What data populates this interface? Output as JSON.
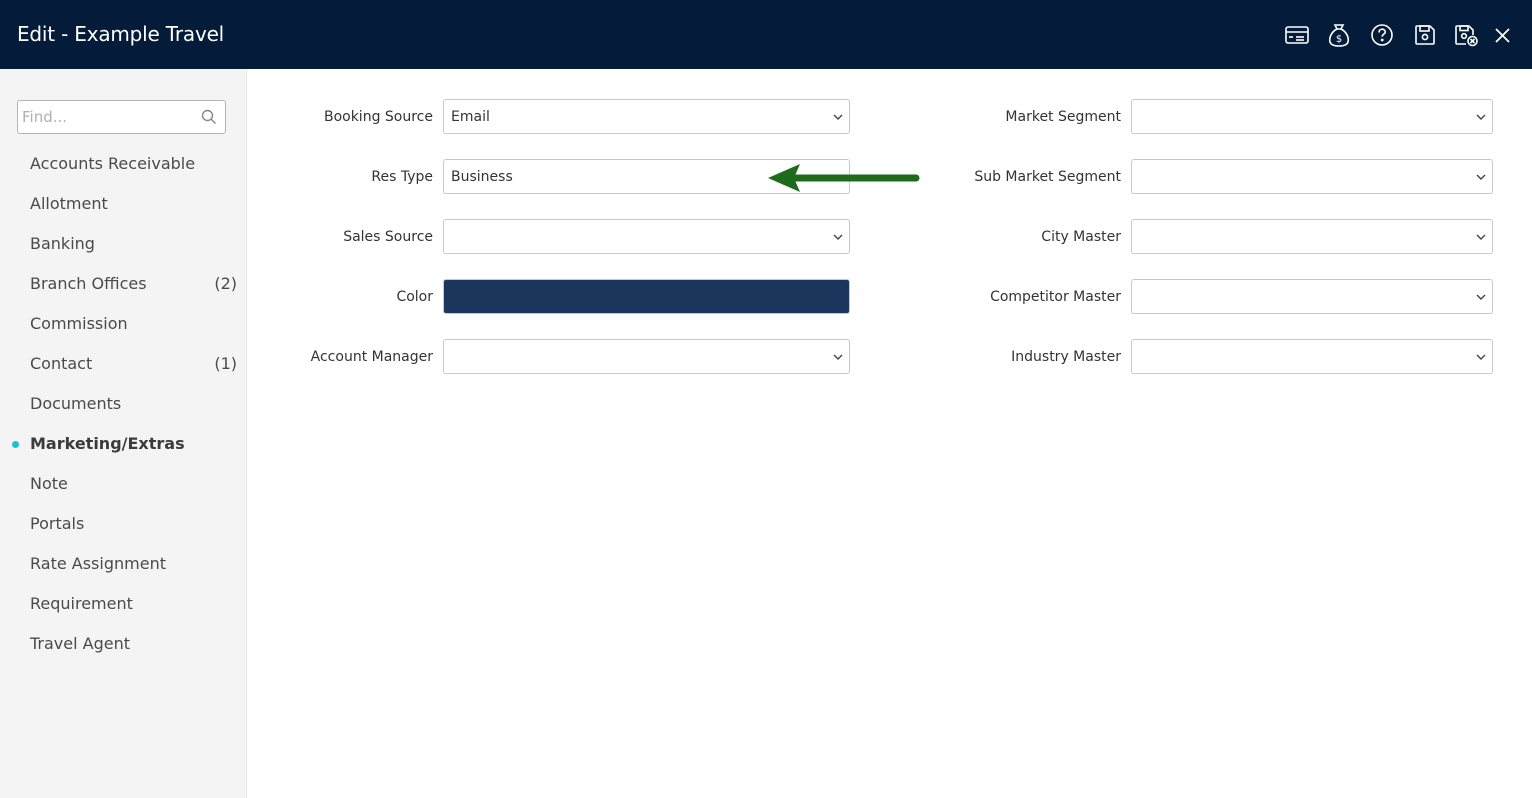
{
  "header": {
    "title": "Edit - Example Travel",
    "icons": [
      "card-icon",
      "money-bag-icon",
      "help-icon",
      "save-icon",
      "save-close-icon",
      "close-icon"
    ],
    "background": "#041c3a"
  },
  "sidebar": {
    "search_placeholder": "Find...",
    "items": [
      {
        "label": "Accounts Receivable",
        "count": ""
      },
      {
        "label": "Allotment",
        "count": ""
      },
      {
        "label": "Banking",
        "count": ""
      },
      {
        "label": "Branch Offices",
        "count": "(2)"
      },
      {
        "label": "Commission",
        "count": ""
      },
      {
        "label": "Contact",
        "count": "(1)"
      },
      {
        "label": "Documents",
        "count": ""
      },
      {
        "label": "Marketing/Extras",
        "count": "",
        "active": true
      },
      {
        "label": "Note",
        "count": ""
      },
      {
        "label": "Portals",
        "count": ""
      },
      {
        "label": "Rate Assignment",
        "count": ""
      },
      {
        "label": "Requirement",
        "count": ""
      },
      {
        "label": "Travel Agent",
        "count": ""
      }
    ],
    "active_dot_color": "#1bc0d2"
  },
  "form": {
    "left": [
      {
        "label": "Booking Source",
        "value": "Email"
      },
      {
        "label": "Res Type",
        "value": "Business"
      },
      {
        "label": "Sales Source",
        "value": ""
      },
      {
        "label": "Color",
        "value": "",
        "color": "#1a365d"
      },
      {
        "label": "Account Manager",
        "value": ""
      }
    ],
    "right": [
      {
        "label": "Market Segment",
        "value": ""
      },
      {
        "label": "Sub Market Segment",
        "value": ""
      },
      {
        "label": "City Master",
        "value": ""
      },
      {
        "label": "Competitor Master",
        "value": ""
      },
      {
        "label": "Industry Master",
        "value": ""
      }
    ]
  },
  "annotation": {
    "arrow_color": "#1e6b1e"
  }
}
